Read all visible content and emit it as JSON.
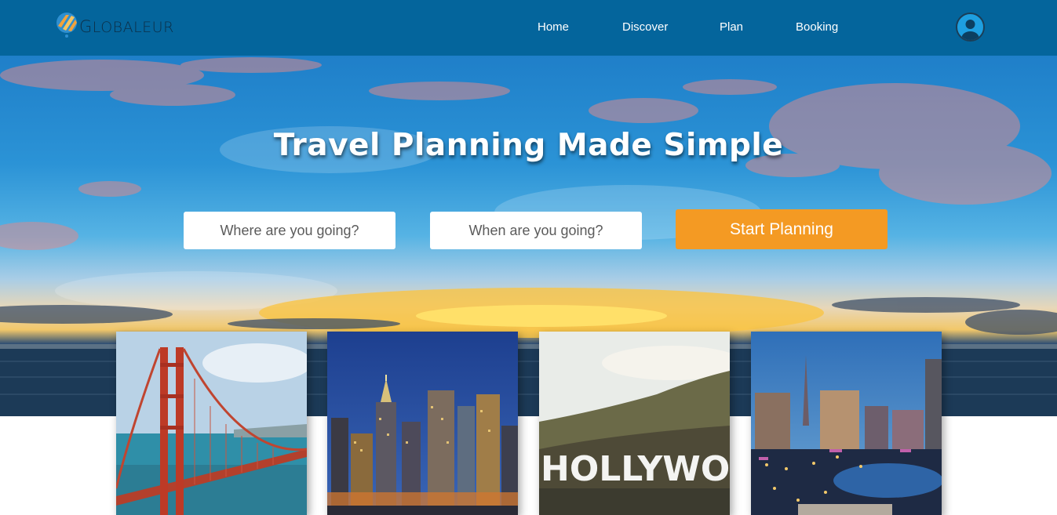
{
  "brand": {
    "name": "Globaleur",
    "logo_text_first": "G",
    "logo_text_rest": "LOBALEUR"
  },
  "nav": {
    "items": [
      {
        "label": "Home"
      },
      {
        "label": "Discover"
      },
      {
        "label": "Plan"
      },
      {
        "label": "Booking"
      }
    ],
    "avatar_icon": "user-avatar-icon"
  },
  "hero": {
    "title": "Travel Planning Made Simple",
    "destination_placeholder": "Where are you going?",
    "date_placeholder": "When are you going?",
    "cta_label": "Start Planning"
  },
  "destinations": [
    {
      "image": "golden-gate-bridge"
    },
    {
      "image": "new-york-skyline"
    },
    {
      "image": "hollywood-sign",
      "sign_text": "HOLLYWOO"
    },
    {
      "image": "las-vegas-strip"
    }
  ],
  "colors": {
    "nav": "#04659c",
    "accent": "#f49a23"
  }
}
